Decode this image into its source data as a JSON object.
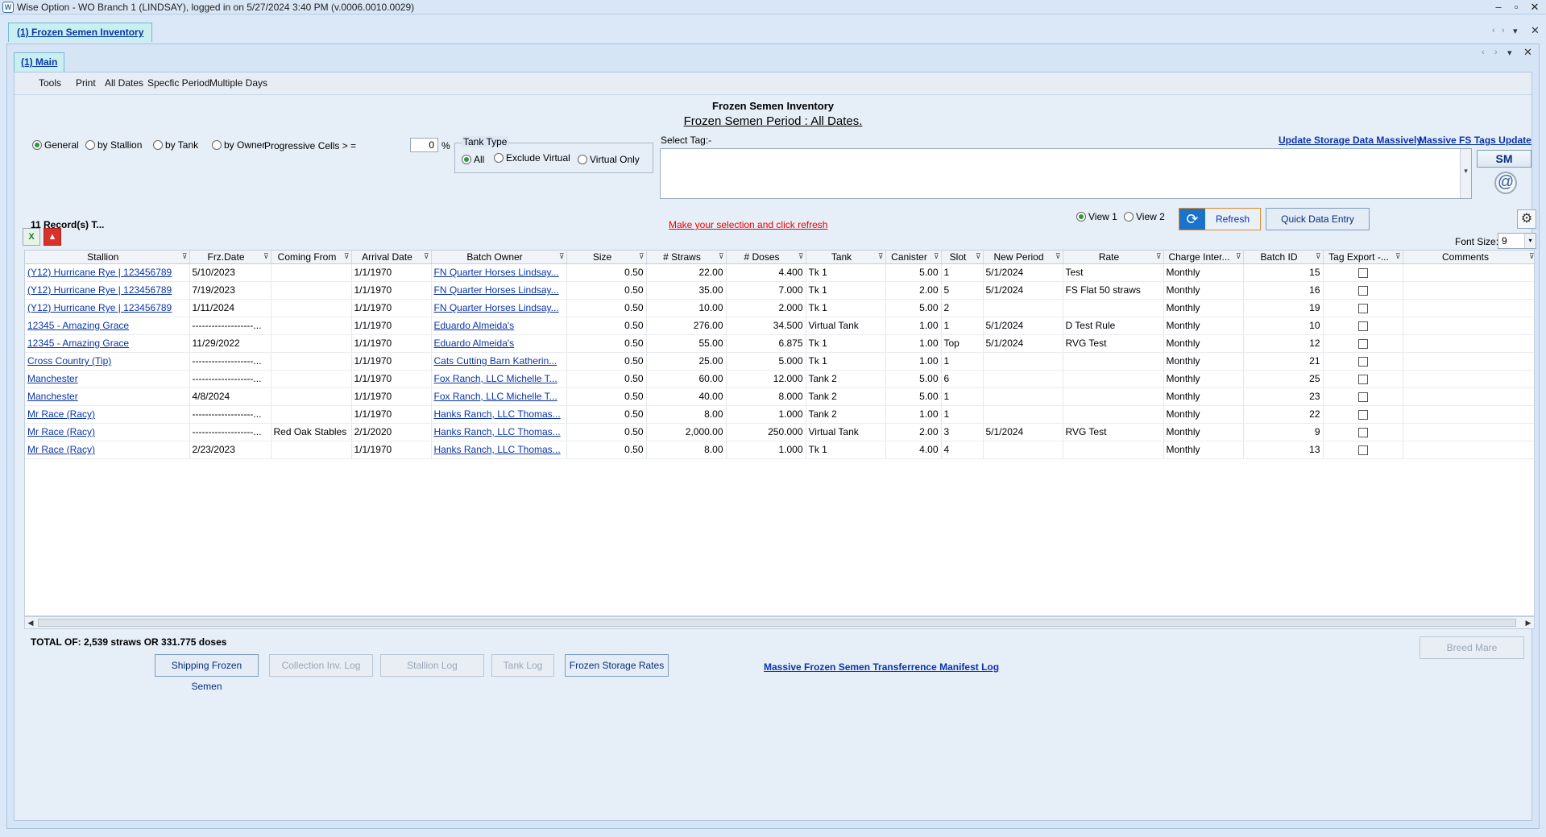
{
  "window": {
    "title": "Wise Option - WO Branch 1 (LINDSAY), logged in on 5/27/2024 3:40 PM (v.0006.0010.0029)",
    "min": "–",
    "max": "▫",
    "close": "✕"
  },
  "outer_tab": {
    "label": "(1) Frozen Semen Inventory"
  },
  "inner_tab": {
    "label": "(1) Main"
  },
  "menu": [
    "Tools",
    "Print",
    "All Dates",
    "Specfic Period",
    "Multiple Days"
  ],
  "heading": {
    "title": "Frozen Semen Inventory",
    "period": "Frozen Semen Period : All Dates."
  },
  "view_by": {
    "general": "General",
    "stallion": "by Stallion",
    "tank": "by Tank",
    "owner": "by Owner",
    "selected": "General"
  },
  "progressive": {
    "label": "Progressive Cells > =",
    "value": "0",
    "unit": "%"
  },
  "tank_type": {
    "legend": "Tank Type",
    "all": "All",
    "exclude": "Exclude Virtual",
    "virtual": "Virtual Only",
    "selected": "All"
  },
  "select_tag": {
    "label": "Select Tag:-",
    "dropdown": "▾"
  },
  "links": {
    "update_storage": "Update Storage Data Massively",
    "massive_fs": "Massive FS Tags Update",
    "manifest": "Massive Frozen Semen Transferrence Manifest Log"
  },
  "sm_button": "SM",
  "at_icon": "@",
  "records": "11  Record(s)  T...",
  "hint": "Make your selection and click refresh",
  "views": {
    "v1": "View 1",
    "v2": "View 2",
    "selected": "View 1"
  },
  "refresh": {
    "icon": "⟳",
    "label": "Refresh"
  },
  "quick_entry": "Quick Data Entry",
  "gear_icon": "⚙",
  "font_size": {
    "label": "Font Size:",
    "value": "9",
    "dropdown": "▾"
  },
  "export_icons": {
    "excel": "X",
    "pdf": "▲"
  },
  "filter_icon": "⊽",
  "columns": [
    "Stallion",
    "Frz.Date",
    "Coming From",
    "Arrival Date",
    "Batch Owner",
    "Size",
    "# Straws",
    "# Doses",
    "Tank",
    "Canister",
    "Slot",
    "New Period",
    "Rate",
    "Charge  Inter...",
    "Batch ID",
    "Tag Export -...",
    "Comments"
  ],
  "rows": [
    {
      "stallion": "(Y12) Hurricane Rye | 123456789",
      "frz": "5/10/2023",
      "from": "",
      "arrival": "1/1/1970",
      "owner": "FN Quarter Horses    Lindsay...",
      "size": "0.50",
      "straws": "22.00",
      "doses": "4.400",
      "tank": "Tk 1",
      "canister": "5.00",
      "slot": "1",
      "period": "5/1/2024",
      "rate": "Test",
      "charge": "Monthly",
      "batch": "15",
      "comments": ""
    },
    {
      "stallion": "(Y12) Hurricane Rye | 123456789",
      "frz": "7/19/2023",
      "from": "",
      "arrival": "1/1/1970",
      "owner": "FN Quarter Horses    Lindsay...",
      "size": "0.50",
      "straws": "35.00",
      "doses": "7.000",
      "tank": "Tk 1",
      "canister": "2.00",
      "slot": "5",
      "period": "5/1/2024",
      "rate": "FS Flat 50 straws",
      "charge": "Monthly",
      "batch": "16",
      "comments": ""
    },
    {
      "stallion": "(Y12) Hurricane Rye | 123456789",
      "frz": "1/11/2024",
      "from": "",
      "arrival": "1/1/1970",
      "owner": "FN Quarter Horses    Lindsay...",
      "size": "0.50",
      "straws": "10.00",
      "doses": "2.000",
      "tank": "Tk 1",
      "canister": "5.00",
      "slot": "2",
      "period": "",
      "rate": "",
      "charge": "Monthly",
      "batch": "19",
      "comments": ""
    },
    {
      "stallion": "12345 - Amazing Grace",
      "frz": "-------------------...",
      "from": "",
      "arrival": "1/1/1970",
      "owner": "Eduardo Almeida's",
      "size": "0.50",
      "straws": "276.00",
      "doses": "34.500",
      "tank": "Virtual Tank",
      "canister": "1.00",
      "slot": "1",
      "period": "5/1/2024",
      "rate": "D Test Rule",
      "charge": "Monthly",
      "batch": "10",
      "comments": ""
    },
    {
      "stallion": "12345 - Amazing Grace",
      "frz": "11/29/2022",
      "from": "",
      "arrival": "1/1/1970",
      "owner": "Eduardo Almeida's",
      "size": "0.50",
      "straws": "55.00",
      "doses": "6.875",
      "tank": "Tk 1",
      "canister": "1.00",
      "slot": "Top",
      "period": "5/1/2024",
      "rate": "RVG Test",
      "charge": "Monthly",
      "batch": "12",
      "comments": ""
    },
    {
      "stallion": "Cross Country (Tip)",
      "frz": "-------------------...",
      "from": "",
      "arrival": "1/1/1970",
      "owner": "Cats Cutting Barn    Katherin...",
      "size": "0.50",
      "straws": "25.00",
      "doses": "5.000",
      "tank": "Tk 1",
      "canister": "1.00",
      "slot": "1",
      "period": "",
      "rate": "",
      "charge": "Monthly",
      "batch": "21",
      "comments": ""
    },
    {
      "stallion": "Manchester",
      "frz": "-------------------...",
      "from": "",
      "arrival": "1/1/1970",
      "owner": "Fox Ranch, LLC    Michelle T...",
      "size": "0.50",
      "straws": "60.00",
      "doses": "12.000",
      "tank": "Tank 2",
      "canister": "5.00",
      "slot": "6",
      "period": "",
      "rate": "",
      "charge": "Monthly",
      "batch": "25",
      "comments": ""
    },
    {
      "stallion": "Manchester",
      "frz": "4/8/2024",
      "from": "",
      "arrival": "1/1/1970",
      "owner": "Fox Ranch, LLC    Michelle T...",
      "size": "0.50",
      "straws": "40.00",
      "doses": "8.000",
      "tank": "Tank 2",
      "canister": "5.00",
      "slot": "1",
      "period": "",
      "rate": "",
      "charge": "Monthly",
      "batch": "23",
      "comments": ""
    },
    {
      "stallion": "Mr Race (Racy)",
      "frz": "-------------------...",
      "from": "",
      "arrival": "1/1/1970",
      "owner": "Hanks Ranch, LLC    Thomas...",
      "size": "0.50",
      "straws": "8.00",
      "doses": "1.000",
      "tank": "Tank 2",
      "canister": "1.00",
      "slot": "1",
      "period": "",
      "rate": "",
      "charge": "Monthly",
      "batch": "22",
      "comments": ""
    },
    {
      "stallion": "Mr Race (Racy)",
      "frz": "-------------------...",
      "from": "Red Oak Stables",
      "arrival": "2/1/2020",
      "owner": "Hanks Ranch, LLC    Thomas...",
      "size": "0.50",
      "straws": "2,000.00",
      "doses": "250.000",
      "tank": "Virtual Tank",
      "canister": "2.00",
      "slot": "3",
      "period": "5/1/2024",
      "rate": "RVG Test",
      "charge": "Monthly",
      "batch": "9",
      "comments": ""
    },
    {
      "stallion": "Mr Race (Racy)",
      "frz": "2/23/2023",
      "from": "",
      "arrival": "1/1/1970",
      "owner": "Hanks Ranch, LLC    Thomas...",
      "size": "0.50",
      "straws": "8.00",
      "doses": "1.000",
      "tank": "Tk 1",
      "canister": "4.00",
      "slot": "4",
      "period": "",
      "rate": "",
      "charge": "Monthly",
      "batch": "13",
      "comments": ""
    }
  ],
  "total": "TOTAL OF: 2,539 straws OR 331.775 doses",
  "buttons": {
    "shipping": "Shipping Frozen Semen",
    "collection": "Collection Inv. Log",
    "stallion_log": "Stallion Log",
    "tank_log": "Tank Log",
    "storage_rates": "Frozen Storage Rates",
    "breed_mare": "Breed Mare"
  }
}
